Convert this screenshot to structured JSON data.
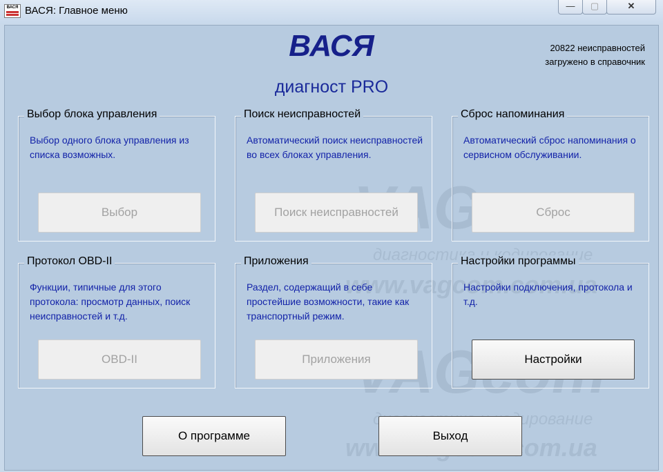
{
  "window": {
    "title": "ВАСЯ:  Главное меню",
    "icon_text": "ВАСЯ",
    "controls": {
      "minimize": "—",
      "maximize": "▢",
      "close": "✕"
    }
  },
  "header": {
    "brand": "ВАСЯ",
    "subtitle": "диагност PRO",
    "info_line1": "20822 неисправностей",
    "info_line2": "загружено в справочник"
  },
  "groups": [
    {
      "title": "Выбор блока управления",
      "description": "Выбор одного блока управления из списка возможных.",
      "button": "Выбор",
      "enabled": false
    },
    {
      "title": "Поиск неисправностей",
      "description": "Автоматический поиск неисправностей во всех блоках управления.",
      "button": "Поиск неисправностей",
      "enabled": false
    },
    {
      "title": "Сброс напоминания",
      "description": "Автоматический сброс напоминания о сервисном обслуживании.",
      "button": "Сброс",
      "enabled": false
    },
    {
      "title": "Протокол OBD-II",
      "description": "Функции, типичные для этого протокола: просмотр данных, поиск неисправностей и т.д.",
      "button": "OBD-II",
      "enabled": false
    },
    {
      "title": "Приложения",
      "description": "Раздел, содержащий в себе простейшие возможности, такие как транспортный режим.",
      "button": "Приложения",
      "enabled": false
    },
    {
      "title": "Настройки программы",
      "description": "Настройки подключения, протокола и т.д.",
      "button": "Настройки",
      "enabled": true
    }
  ],
  "footer": {
    "about": "О программе",
    "exit": "Выход"
  },
  "watermark": {
    "logo": "VAGcom",
    "tagline": "диагностика и кодирование",
    "url": "www.vagcom.com.ua"
  }
}
